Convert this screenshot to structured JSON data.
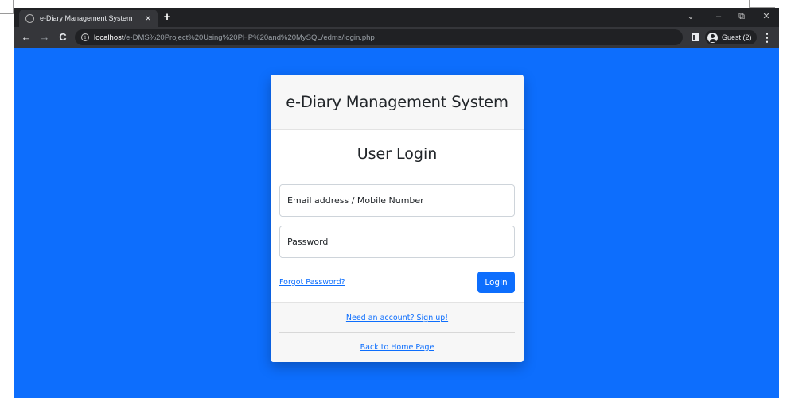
{
  "browser": {
    "tab_title": "e-Diary Management System",
    "tab_close": "×",
    "new_tab": "+",
    "url_host": "localhost",
    "url_path": "/e-DMS%20Project%20Using%20PHP%20and%20MySQL/edms/login.php",
    "profile_label": "Guest (2)",
    "icons": {
      "back": "←",
      "forward": "→",
      "reload": "C",
      "info": "i",
      "menu": "⋮",
      "tab_search": "⌄",
      "minimize": "–",
      "restore": "⧉",
      "close": "✕"
    }
  },
  "colors": {
    "page_background": "#0d6efd",
    "primary": "#0d6efd",
    "chrome_dark": "#202124",
    "chrome_tab": "#35363a"
  },
  "card": {
    "header_title": "e-Diary Management System",
    "login_title": "User Login",
    "email_placeholder": "Email address / Mobile Number",
    "password_placeholder": "Password",
    "forgot_link": "Forgot Password?",
    "login_button": "Login",
    "signup_link": "Need an account? Sign up!",
    "home_link": "Back to Home Page"
  }
}
